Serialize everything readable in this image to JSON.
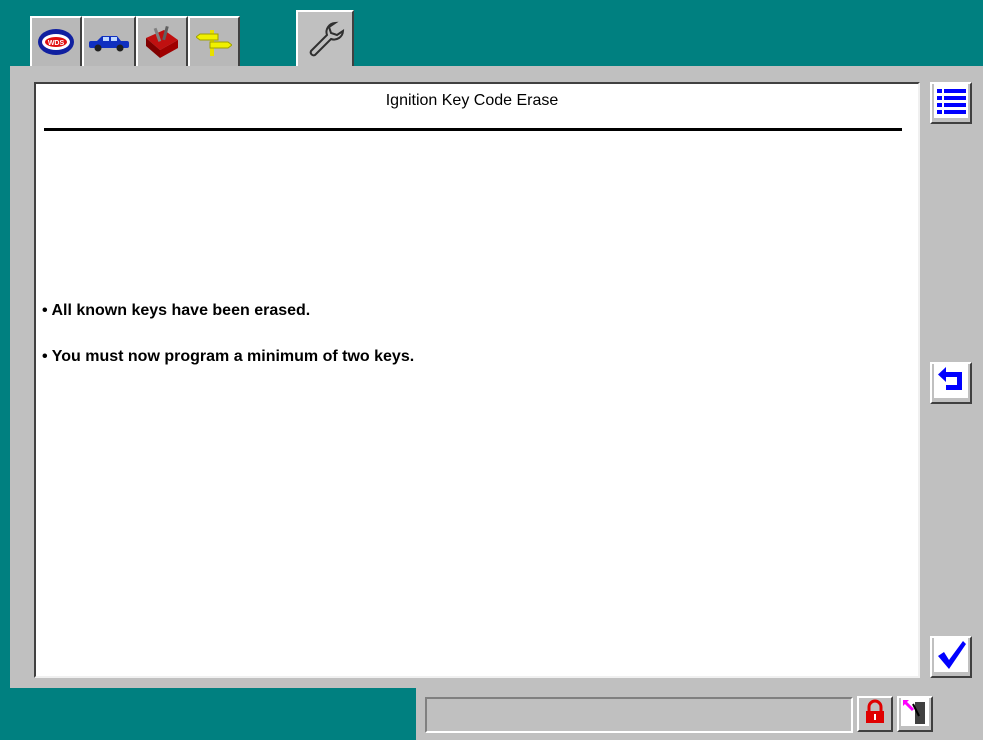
{
  "tabs": [
    {
      "icon": "wds-logo-icon"
    },
    {
      "icon": "vehicle-icon"
    },
    {
      "icon": "toolbox-icon"
    },
    {
      "icon": "signpost-icon"
    },
    {
      "icon": "wrench-icon"
    }
  ],
  "panel": {
    "title": "Ignition Key Code Erase",
    "messages": [
      "• All known keys have been erased.",
      "• You must now program a minimum of two keys."
    ]
  },
  "side_buttons": [
    {
      "icon": "list-icon"
    },
    {
      "icon": "return-icon"
    },
    {
      "icon": "checkmark-icon"
    }
  ],
  "status_bar": {
    "status_text": "",
    "lock_icon": "padlock-icon",
    "connector_icon": "connector-icon"
  },
  "colors": {
    "background": "#008080",
    "frame": "#c0c0c0",
    "accent_blue": "#0000ff",
    "lock_red": "#e00000"
  }
}
